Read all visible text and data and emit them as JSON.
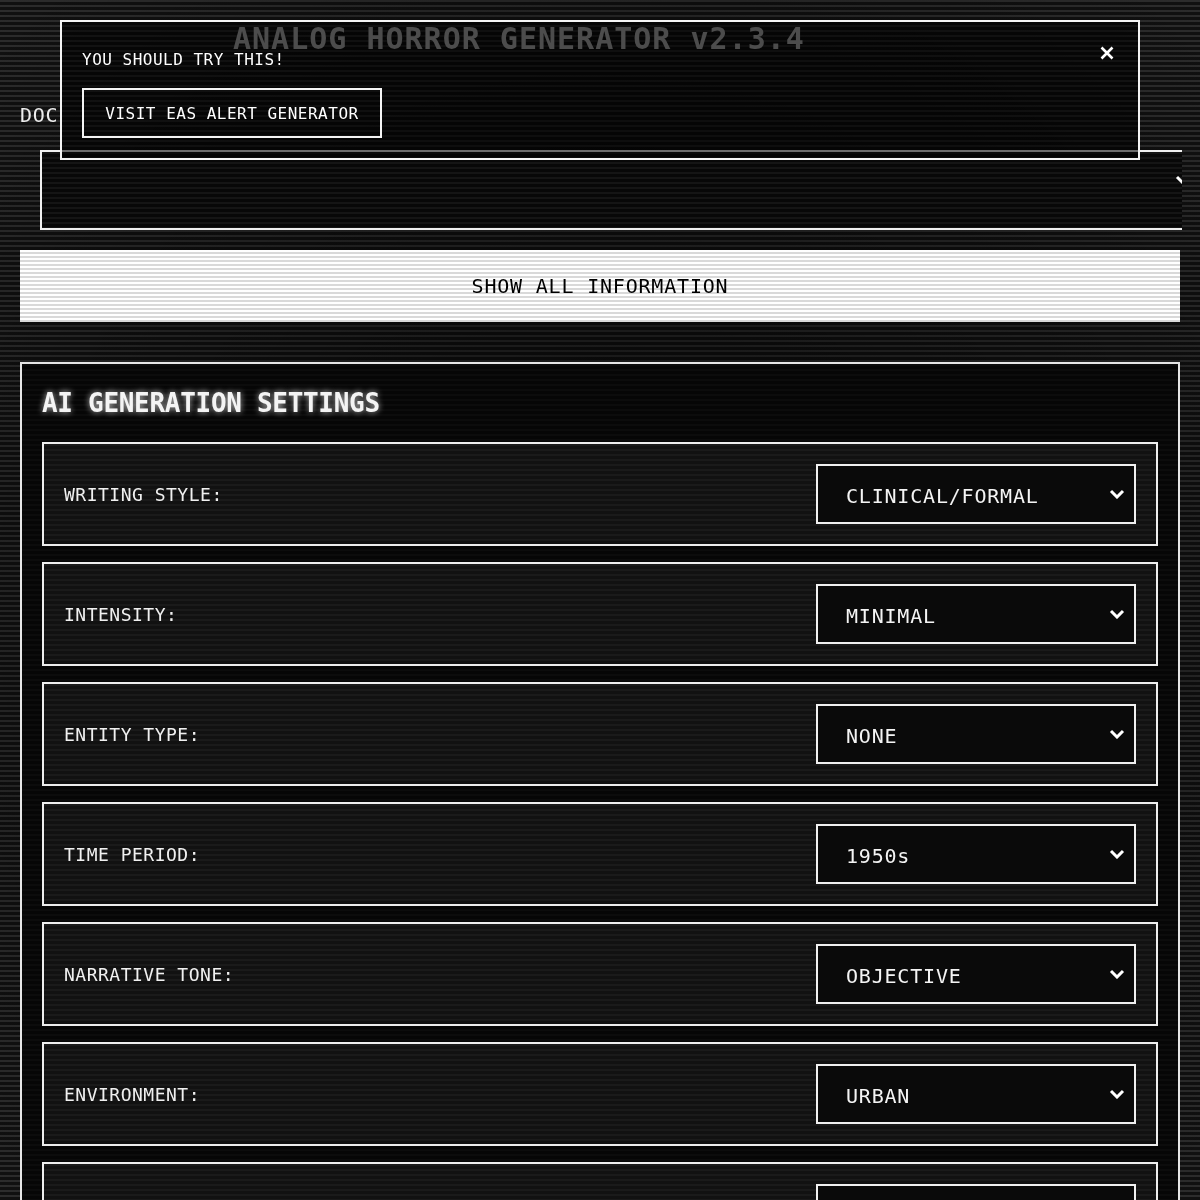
{
  "header": {
    "title": "ANALOG HORROR GENERATOR v2.3.4"
  },
  "promo_popup": {
    "message": "YOU SHOULD TRY THIS!",
    "button": "VISIT EAS ALERT GENERATOR"
  },
  "document_type": {
    "label": "DOC"
  },
  "show_all_button": "SHOW ALL INFORMATION",
  "ai_settings": {
    "title": "AI GENERATION SETTINGS",
    "settings": [
      {
        "label": "WRITING STYLE:",
        "value": "CLINICAL/FORMAL"
      },
      {
        "label": "INTENSITY:",
        "value": "MINIMAL"
      },
      {
        "label": "ENTITY TYPE:",
        "value": "NONE"
      },
      {
        "label": "TIME PERIOD:",
        "value": "1950s"
      },
      {
        "label": "NARRATIVE TONE:",
        "value": "OBJECTIVE"
      },
      {
        "label": "ENVIRONMENT:",
        "value": "URBAN"
      }
    ],
    "more_rows_below": true
  }
}
